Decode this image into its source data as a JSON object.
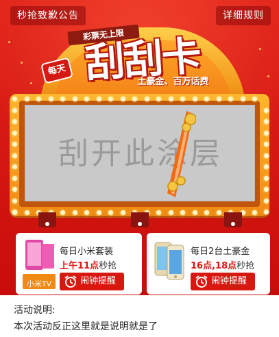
{
  "header": {
    "notice_button": "秒抢致歉公告",
    "rules_button": "详细规则"
  },
  "banner": {
    "daily_badge": "每天",
    "subtitle": "彩票无上限",
    "title": "刮刮卡",
    "prizes": "土豪金、百万话费"
  },
  "scratch_card": {
    "overlay_text": "刮开此涂层"
  },
  "prizes": [
    {
      "title": "每日小米套装",
      "time_prefix": "",
      "time_highlight": "上午11点",
      "time_suffix": "秒抢",
      "alarm_label": "闹钟提醒",
      "thumb_label": "小米TV"
    },
    {
      "title": "每日2台土豪金",
      "time_prefix": "",
      "time_highlight": "16点,18点",
      "time_suffix": "秒抢",
      "alarm_label": "闹钟提醒"
    }
  ],
  "description": {
    "title": "活动说明:",
    "body": "本次活动反正这里就是说明就是了"
  },
  "colors": {
    "background_red": "#d7140f",
    "accent_orange": "#f39a1c",
    "highlight_red": "#e2120e"
  }
}
